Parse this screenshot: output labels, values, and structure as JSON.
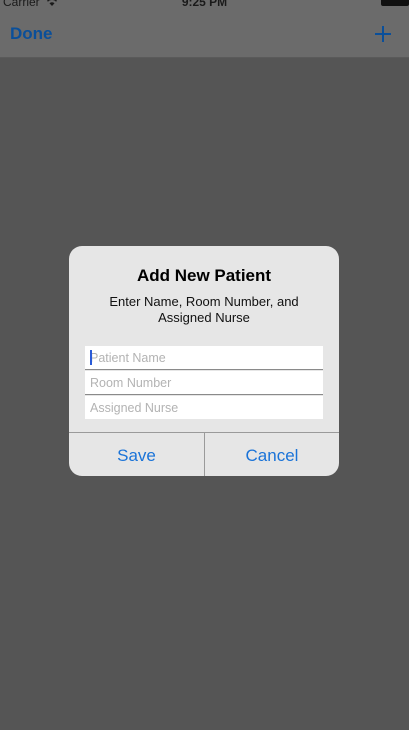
{
  "status_bar": {
    "carrier": "Carrier",
    "time": "9:25 PM",
    "icons": [
      "wifi-icon",
      "battery-icon"
    ]
  },
  "nav_bar": {
    "done_label": "Done",
    "add_icon": "plus-icon",
    "accent_color": "#0a4f9a"
  },
  "dialog": {
    "title": "Add New Patient",
    "message": "Enter Name, Room Number, and Assigned Nurse",
    "fields": [
      {
        "placeholder": "Patient Name",
        "value": ""
      },
      {
        "placeholder": "Room Number",
        "value": ""
      },
      {
        "placeholder": "Assigned Nurse",
        "value": ""
      }
    ],
    "save_label": "Save",
    "cancel_label": "Cancel",
    "action_color": "#1a73d8"
  }
}
